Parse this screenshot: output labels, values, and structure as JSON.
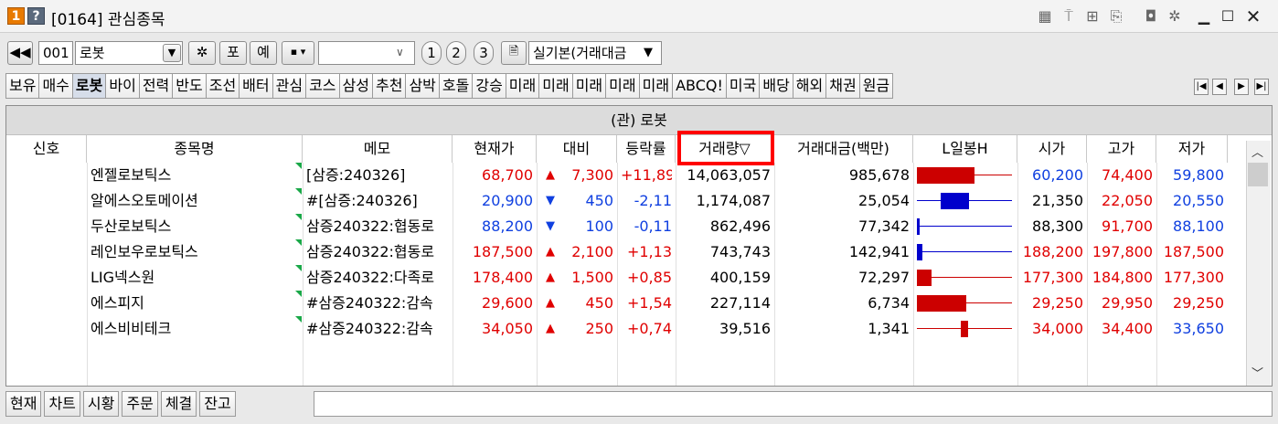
{
  "window": {
    "badge1": "1",
    "badge2": "?",
    "title": "[0164] 관심종목"
  },
  "toolbar": {
    "group_code": "001",
    "group_name": "로봇",
    "po_label": "포",
    "ye_label": "예",
    "page_buttons": [
      "1",
      "2",
      "3"
    ],
    "layout_select": "실기본(거래대금"
  },
  "tabs": [
    "보유",
    "매수",
    "로봇",
    "바이",
    "전력",
    "반도",
    "조선",
    "배터",
    "관심",
    "코스",
    "삼성",
    "추천",
    "삼박",
    "호돌",
    "강승",
    "미래",
    "미래",
    "미래",
    "미래",
    "미래",
    "ABCQ!",
    "미국",
    "배당",
    "해외",
    "채권",
    "원금"
  ],
  "active_tab": "로봇",
  "grid": {
    "title": "(관) 로봇",
    "columns": [
      "신호",
      "종목명",
      "메모",
      "현재가",
      "대비",
      "등락률",
      "거래량▽",
      "거래대금(백만)",
      "L일봉H",
      "시가",
      "고가",
      "저가"
    ],
    "rows": [
      {
        "name": "엔젤로보틱스",
        "memo": "[삼증:240326]",
        "price": "68,700",
        "dir": "up",
        "diff": "7,300",
        "rate": "+11,89",
        "vol": "14,063,057",
        "amt": "985,678",
        "open": "60,200",
        "high": "74,400",
        "low": "59,800",
        "c_price": "red",
        "c_open": "blue",
        "c_high": "red",
        "c_low": "blue",
        "bar": {
          "kind": "up",
          "start": 0.0,
          "end": 0.61
        }
      },
      {
        "name": "알에스오토메이션",
        "memo": "#[삼증:240326]",
        "price": "20,900",
        "dir": "down",
        "diff": "450",
        "rate": "-2,11",
        "vol": "1,174,087",
        "amt": "25,054",
        "open": "21,350",
        "high": "22,050",
        "low": "20,550",
        "c_price": "blue",
        "c_open": "black",
        "c_high": "red",
        "c_low": "blue",
        "bar": {
          "kind": "down",
          "start": 0.25,
          "end": 0.55
        }
      },
      {
        "name": "두산로보틱스",
        "memo": "삼증240322:협동로",
        "price": "88,200",
        "dir": "down",
        "diff": "100",
        "rate": "-0,11",
        "vol": "862,496",
        "amt": "77,342",
        "open": "88,300",
        "high": "91,700",
        "low": "88,100",
        "c_price": "blue",
        "c_open": "black",
        "c_high": "red",
        "c_low": "blue",
        "bar": {
          "kind": "down",
          "start": 0.0,
          "end": 0.03
        }
      },
      {
        "name": "레인보우로보틱스",
        "memo": "삼증240322:협동로",
        "price": "187,500",
        "dir": "up",
        "diff": "2,100",
        "rate": "+1,13",
        "vol": "743,743",
        "amt": "142,941",
        "open": "188,200",
        "high": "197,800",
        "low": "187,500",
        "c_price": "red",
        "c_open": "red",
        "c_high": "red",
        "c_low": "red",
        "bar": {
          "kind": "down",
          "start": 0.0,
          "end": 0.06
        }
      },
      {
        "name": "LIG넥스원",
        "memo": "삼증240322:다족로",
        "price": "178,400",
        "dir": "up",
        "diff": "1,500",
        "rate": "+0,85",
        "vol": "400,159",
        "amt": "72,297",
        "open": "177,300",
        "high": "184,800",
        "low": "177,300",
        "c_price": "red",
        "c_open": "red",
        "c_high": "red",
        "c_low": "red",
        "bar": {
          "kind": "up",
          "start": 0.0,
          "end": 0.15
        }
      },
      {
        "name": "에스피지",
        "memo": "#삼증240322:감속",
        "price": "29,600",
        "dir": "up",
        "diff": "450",
        "rate": "+1,54",
        "vol": "227,114",
        "amt": "6,734",
        "open": "29,250",
        "high": "29,950",
        "low": "29,250",
        "c_price": "red",
        "c_open": "red",
        "c_high": "red",
        "c_low": "red",
        "bar": {
          "kind": "up",
          "start": 0.0,
          "end": 0.52
        }
      },
      {
        "name": "에스비비테크",
        "memo": "#삼증240322:감속",
        "price": "34,050",
        "dir": "up",
        "diff": "250",
        "rate": "+0,74",
        "vol": "39,516",
        "amt": "1,341",
        "open": "34,000",
        "high": "34,400",
        "low": "33,650",
        "c_price": "red",
        "c_open": "red",
        "c_high": "red",
        "c_low": "blue",
        "bar": {
          "kind": "up",
          "start": 0.46,
          "end": 0.54
        }
      }
    ]
  },
  "bottom_tabs": [
    "현재",
    "차트",
    "시황",
    "주문",
    "체결",
    "잔고"
  ],
  "colors": {
    "up": "#e00000",
    "down": "#1040e0",
    "candle_up": "#cc0000",
    "candle_down": "#0000cc",
    "highlight": "#ff0000"
  }
}
